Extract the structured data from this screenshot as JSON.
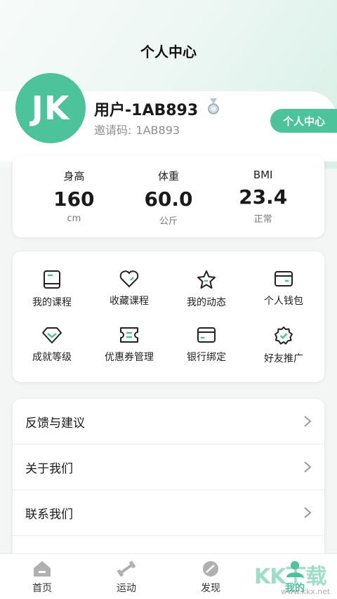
{
  "header": {
    "title": "个人中心"
  },
  "profile": {
    "avatar_initials": "JK",
    "username": "用户-1AB893",
    "invite_label": "邀请码:",
    "invite_code": "1AB893",
    "center_button": "个人中心",
    "badge_icon": "medal-icon"
  },
  "stats": [
    {
      "label": "身高",
      "value": "160",
      "unit": "cm"
    },
    {
      "label": "体重",
      "value": "60.0",
      "unit": "公斤"
    },
    {
      "label": "BMI",
      "value": "23.4",
      "unit": "正常"
    }
  ],
  "grid": [
    {
      "label": "我的课程",
      "icon": "book-icon"
    },
    {
      "label": "收藏课程",
      "icon": "heart-icon"
    },
    {
      "label": "我的动态",
      "icon": "star-icon"
    },
    {
      "label": "个人钱包",
      "icon": "wallet-icon"
    },
    {
      "label": "成就等级",
      "icon": "diamond-icon"
    },
    {
      "label": "优惠券管理",
      "icon": "coupon-icon"
    },
    {
      "label": "银行绑定",
      "icon": "card-icon"
    },
    {
      "label": "好友推广",
      "icon": "badge-check-icon"
    }
  ],
  "list": [
    {
      "label": "反馈与建议"
    },
    {
      "label": "关于我们"
    },
    {
      "label": "联系我们"
    },
    {
      "label": ""
    }
  ],
  "tabs": [
    {
      "label": "首页",
      "icon": "home-icon",
      "active": false
    },
    {
      "label": "运动",
      "icon": "dumbbell-icon",
      "active": false
    },
    {
      "label": "发现",
      "icon": "discover-icon",
      "active": false
    },
    {
      "label": "我的",
      "icon": "user-icon",
      "active": true
    }
  ],
  "watermark": {
    "text": "KK下载",
    "sub": "www.kkx.net"
  },
  "colors": {
    "accent": "#4cc39a",
    "text": "#1a1a1a",
    "muted": "#8f8f8f"
  }
}
